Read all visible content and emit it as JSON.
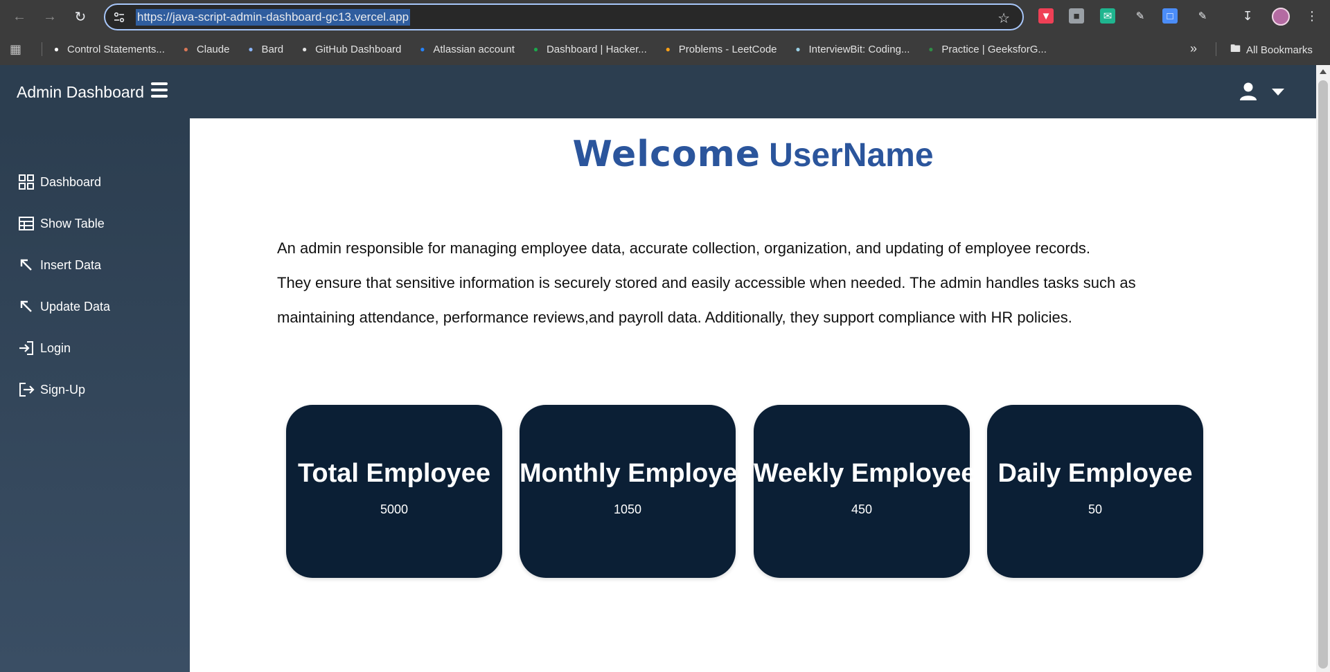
{
  "browser": {
    "url": "https://java-script-admin-dashboard-gc13.vercel.app",
    "bookmarks": [
      {
        "label": "Control Statements...",
        "icon": "openai-icon",
        "color": "#ffffff"
      },
      {
        "label": "Claude",
        "icon": "claude-icon",
        "color": "#d97757"
      },
      {
        "label": "Bard",
        "icon": "bard-icon",
        "color": "#8ab4f8"
      },
      {
        "label": "GitHub Dashboard",
        "icon": "github-icon",
        "color": "#e3e3e3"
      },
      {
        "label": "Atlassian account",
        "icon": "atlassian-icon",
        "color": "#2684ff"
      },
      {
        "label": "Dashboard | Hacker...",
        "icon": "hackerrank-icon",
        "color": "#1ba94c"
      },
      {
        "label": "Problems - LeetCode",
        "icon": "leetcode-icon",
        "color": "#ffa116"
      },
      {
        "label": "InterviewBit: Coding...",
        "icon": "interviewbit-icon",
        "color": "#9ad0e6"
      },
      {
        "label": "Practice | GeeksforG...",
        "icon": "geeksforgeeks-icon",
        "color": "#2f8d46"
      }
    ],
    "all_bookmarks": "All Bookmarks"
  },
  "app": {
    "brand": "Admin Dashboard",
    "menu": [
      {
        "label": "Dashboard",
        "icon": "grid-icon"
      },
      {
        "label": "Show Table",
        "icon": "table-icon"
      },
      {
        "label": "Insert Data",
        "icon": "arrow-up-left-icon"
      },
      {
        "label": "Update Data",
        "icon": "arrow-up-left-icon"
      },
      {
        "label": "Login",
        "icon": "login-icon"
      },
      {
        "label": "Sign-Up",
        "icon": "logout-icon"
      }
    ],
    "welcome": "Welcome",
    "username": "UserName",
    "description": [
      "An admin responsible for managing employee data, accurate collection, organization, and updating of employee records.",
      "They ensure that sensitive information is securely stored and easily accessible when needed. The admin handles tasks such as",
      "maintaining attendance, performance reviews,and payroll data. Additionally, they support compliance with HR policies."
    ],
    "cards": [
      {
        "title": "Total Employee",
        "value": "5000"
      },
      {
        "title": "Monthly Employee",
        "value": "1050"
      },
      {
        "title": "Weekly Employee",
        "value": "450"
      },
      {
        "title": "Daily Employee",
        "value": "50"
      }
    ]
  },
  "colors": {
    "header": "#2c3e50",
    "card": "#0b1f35",
    "welcome": "#2b559c"
  }
}
